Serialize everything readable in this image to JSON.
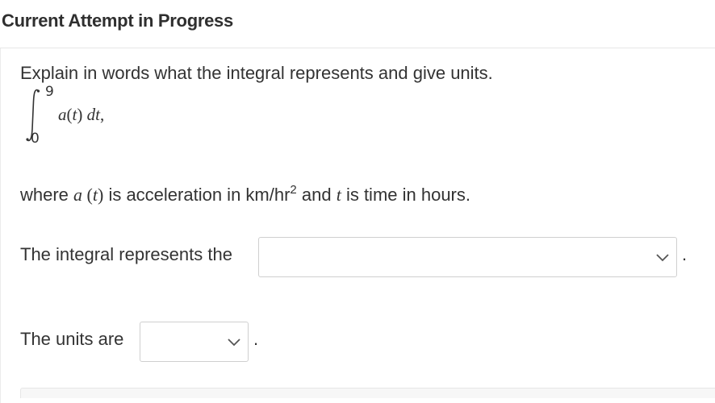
{
  "header": {
    "title": "Current Attempt in Progress"
  },
  "question": {
    "prompt": "Explain in words what the integral represents and give units.",
    "integral": {
      "upper": "9",
      "lower": "0",
      "integrand_func": "a",
      "integrand_paren_open": "(",
      "integrand_var": "t",
      "integrand_paren_close": ")",
      "differential": "dt",
      "trailing": ","
    },
    "where_line": {
      "prefix": "where ",
      "func": "a",
      "arg_open": " (",
      "arg": "t",
      "arg_close": ")",
      "middle": " is acceleration in km/hr",
      "exponent": "2",
      "middle2": " and ",
      "var": "t",
      "suffix": " is time in hours."
    }
  },
  "answer_rows": {
    "represents": {
      "label": "The integral represents the",
      "selected_value": "",
      "trailing": "."
    },
    "units": {
      "label": "The units are",
      "selected_value": "",
      "trailing": "."
    }
  },
  "icons": {
    "dropdown": "chevron-down-icon"
  },
  "colors": {
    "text": "#333333",
    "border": "#cfcfcf",
    "divider": "#e6e6e6"
  }
}
